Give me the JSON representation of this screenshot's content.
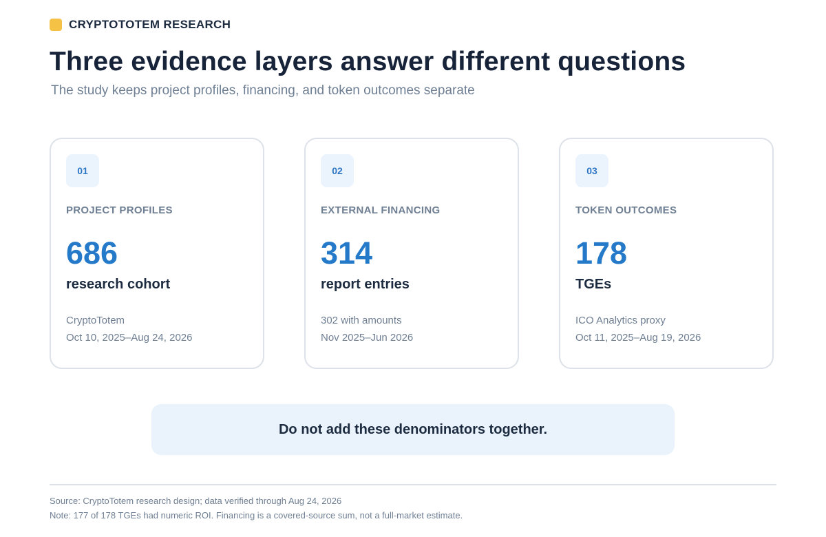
{
  "header": {
    "brand": "CRYPTOTOTEM RESEARCH",
    "brand_color": "#f6c245",
    "title": "Three evidence layers answer different questions",
    "subtitle": "The study keeps project profiles, financing, and token outcomes separate"
  },
  "cards": [
    {
      "number": "01",
      "label": "PROJECT PROFILES",
      "value": "686",
      "unit": "research cohort",
      "detail_1": "CryptoTotem",
      "detail_2": "Oct 10, 2025–Aug 24, 2026"
    },
    {
      "number": "02",
      "label": "EXTERNAL FINANCING",
      "value": "314",
      "unit": "report entries",
      "detail_1": "302 with amounts",
      "detail_2": "Nov 2025–Jun 2026"
    },
    {
      "number": "03",
      "label": "TOKEN OUTCOMES",
      "value": "178",
      "unit": "TGEs",
      "detail_1": "ICO Analytics proxy",
      "detail_2": "Oct 11, 2025–Aug 19, 2026"
    }
  ],
  "callout": {
    "text": "Do not add these denominators together."
  },
  "footer": {
    "source": "Source: CryptoTotem research design; data verified through Aug 24, 2026",
    "note": "Note: 177 of 178 TGEs had numeric ROI. Financing is a covered-source sum, not a full-market estimate."
  },
  "colors": {
    "accent": "#2479c9",
    "badge_background": "#ebf3fd",
    "callout_background": "#eaf3fc",
    "muted_text": "#6f7f93",
    "heading_text": "#172338"
  }
}
